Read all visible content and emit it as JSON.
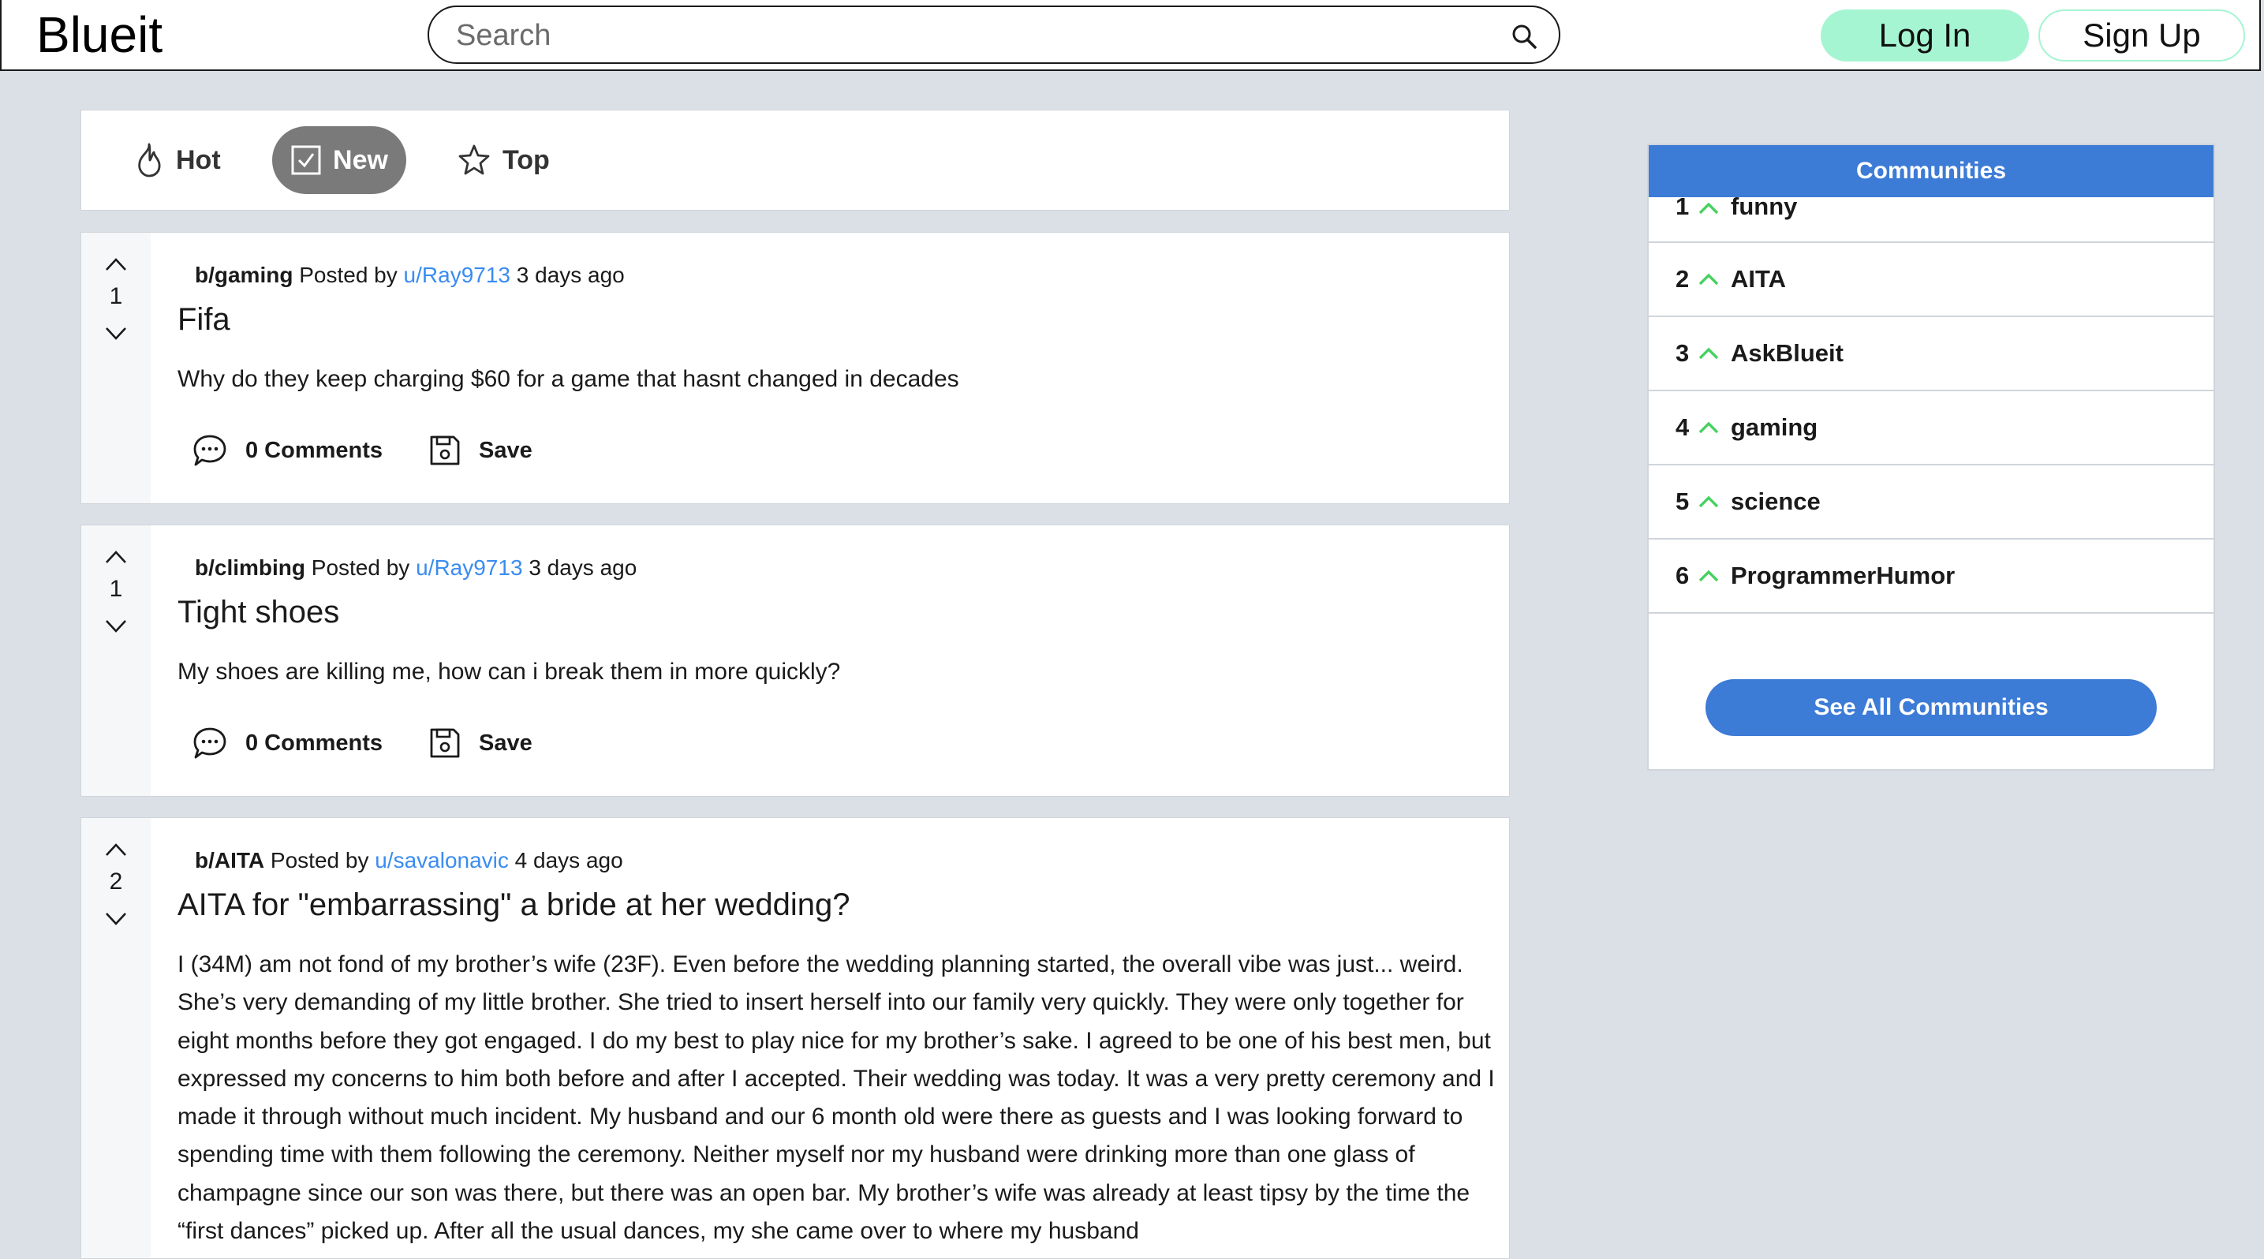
{
  "header": {
    "logo": "Blueit",
    "search_placeholder": "Search",
    "login_label": "Log In",
    "signup_label": "Sign Up"
  },
  "sort": {
    "hot": "Hot",
    "new": "New",
    "top": "Top",
    "active": "New"
  },
  "posts": [
    {
      "subreddit": "b/gaming",
      "posted_by": "Posted by",
      "user": "u/Ray9713",
      "time": "3 days ago",
      "score": "1",
      "title": "Fifa",
      "body": "Why do they keep charging $60 for a game that hasnt changed in decades",
      "comments": "0 Comments",
      "save": "Save"
    },
    {
      "subreddit": "b/climbing",
      "posted_by": "Posted by",
      "user": "u/Ray9713",
      "time": "3 days ago",
      "score": "1",
      "title": "Tight shoes",
      "body": "My shoes are killing me, how can i break them in more quickly?",
      "comments": "0 Comments",
      "save": "Save"
    },
    {
      "subreddit": "b/AITA",
      "posted_by": "Posted by",
      "user": "u/savalonavic",
      "time": "4 days ago",
      "score": "2",
      "title": "AITA for \"embarrassing\" a bride at her wedding?",
      "body": "I (34M) am not fond of my brother’s wife (23F). Even before the wedding planning started, the overall vibe was just... weird. She’s very demanding of my little brother. She tried to insert herself into our family very quickly. They were only together for eight months before they got engaged. I do my best to play nice for my brother’s sake. I agreed to be one of his best men, but expressed my concerns to him both before and after I accepted. Their wedding was today. It was a very pretty ceremony and I made it through without much incident. My husband and our 6 month old were there as guests and I was looking forward to spending time with them following the ceremony. Neither myself nor my husband were drinking more than one glass of champagne since our son was there, but there was an open bar. My brother’s wife was already at least tipsy by the time the “first dances” picked up. After all the usual dances, my she came over to where my husband"
    }
  ],
  "sidebar": {
    "title": "Communities",
    "communities": [
      {
        "rank": "1",
        "name": "funny"
      },
      {
        "rank": "2",
        "name": "AITA"
      },
      {
        "rank": "3",
        "name": "AskBlueit"
      },
      {
        "rank": "4",
        "name": "gaming"
      },
      {
        "rank": "5",
        "name": "science"
      },
      {
        "rank": "6",
        "name": "ProgrammerHumor"
      }
    ],
    "see_all_label": "See All Communities"
  },
  "colors": {
    "accent": "#3c7bd6",
    "login_bg": "#a6f5d2",
    "user_link": "#3a8cf0",
    "upvote_caret": "#46d160",
    "page_bg": "#dae0e6"
  }
}
